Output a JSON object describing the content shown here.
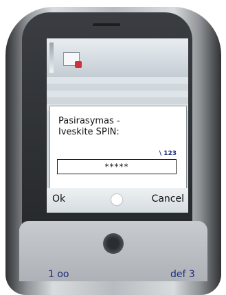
{
  "dialog": {
    "prompt_line1": "Pasirasymas -",
    "prompt_line2": "Iveskite SPIN:",
    "input_mode": "\\ 123",
    "pin_value": "*****"
  },
  "softkeys": {
    "left": "Ok",
    "right": "Cancel"
  },
  "keypad": {
    "left": "1 oo",
    "right": "def 3"
  }
}
